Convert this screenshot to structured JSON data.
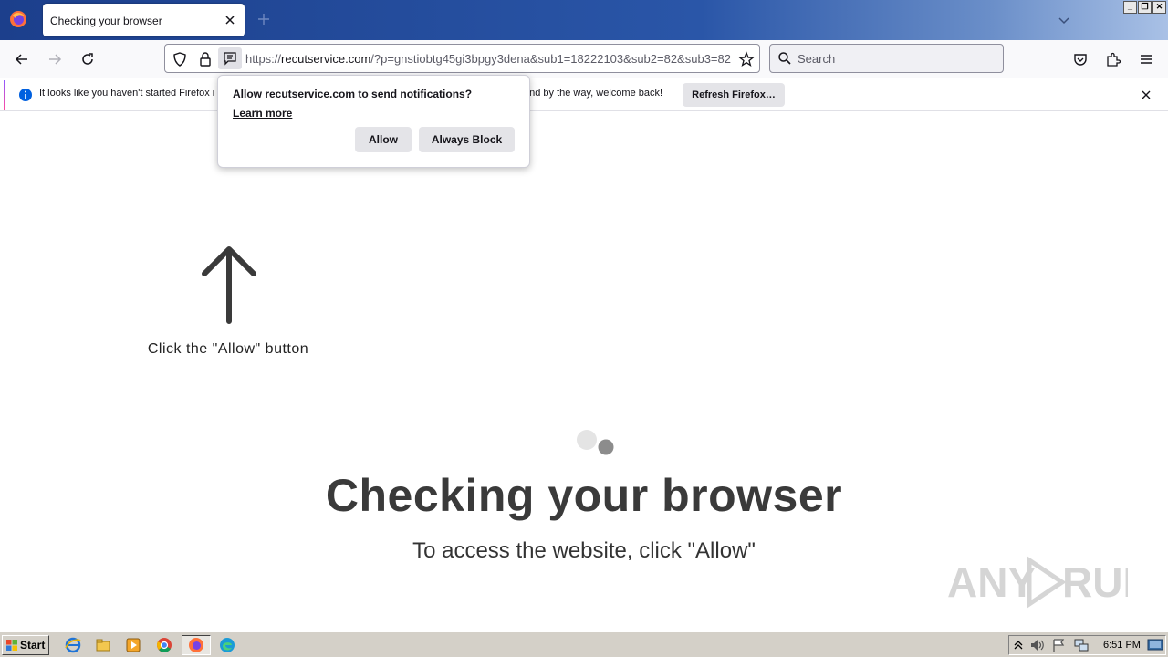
{
  "browser": {
    "tab": {
      "title": "Checking your browser"
    },
    "url": {
      "prefix": "https://",
      "host": "recutservice.com",
      "path": "/?p=gnstiobtg45gi3bpgy3dena&sub1=18222103&sub2=82&sub3=82"
    },
    "search": {
      "placeholder": "Search"
    },
    "notification_bar": {
      "text_left": "It looks like you haven't started Firefox i",
      "text_right": "and by the way, welcome back!",
      "refresh_label": "Refresh Firefox…"
    },
    "permission_popup": {
      "title": "Allow recutservice.com to send notifications?",
      "learn_more": "Learn more",
      "allow_label": "Allow",
      "block_label": "Always Block"
    }
  },
  "page": {
    "click_hint": "Click the \"Allow\" button",
    "heading": "Checking your browser",
    "subheading": "To access the website, click \"Allow\""
  },
  "taskbar": {
    "start_label": "Start",
    "clock": "6:51 PM"
  },
  "colors": {
    "titlebar_start": "#1c3f8c",
    "heading": "#3a3a3a",
    "info_blue": "#0060df"
  }
}
